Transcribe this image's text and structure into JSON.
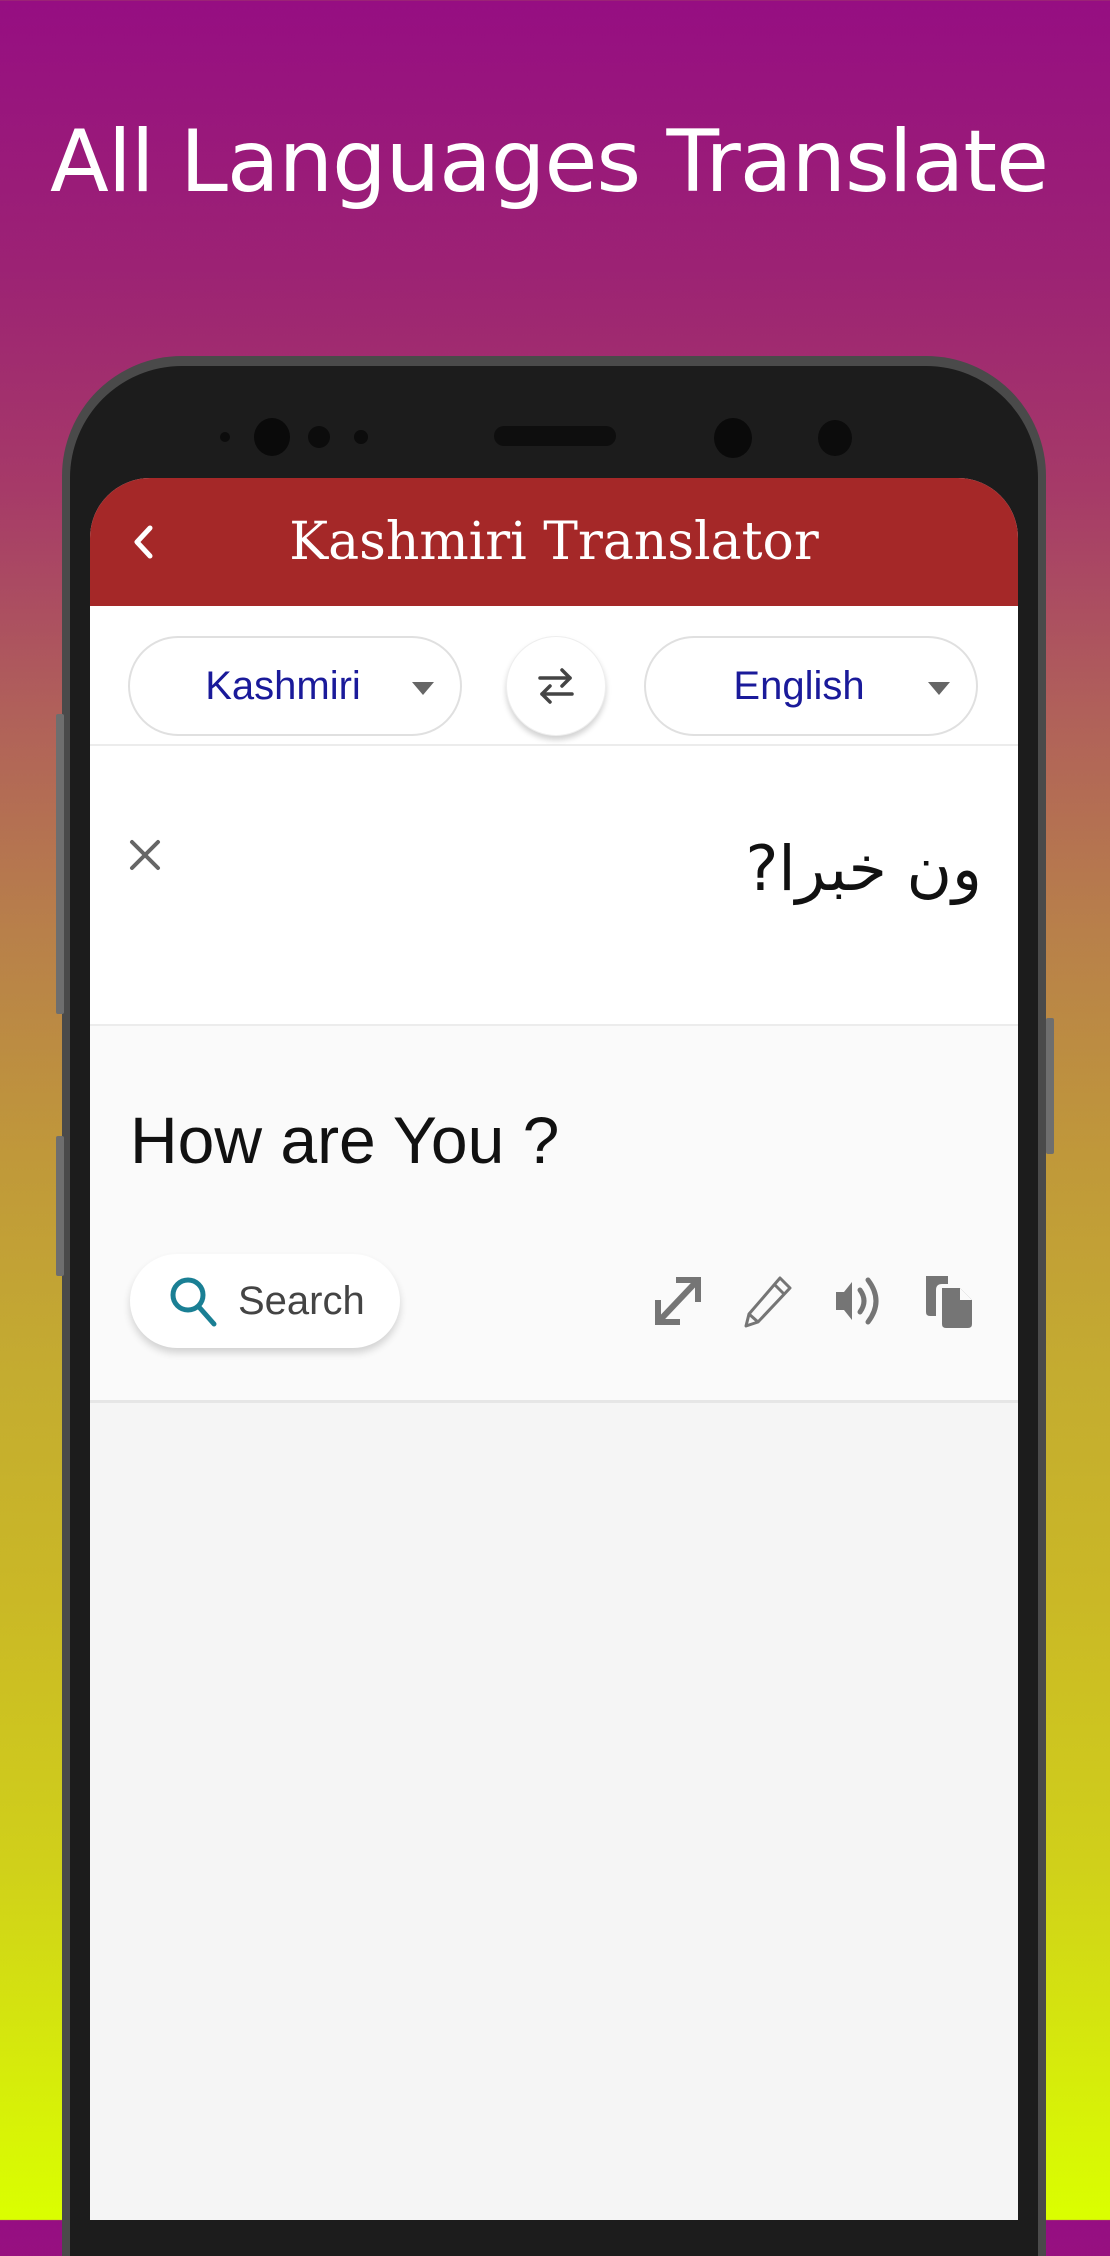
{
  "promo": {
    "headline": "All Languages Translate"
  },
  "appbar": {
    "title": "Kashmiri Translator",
    "back_icon": "chevron-left-icon"
  },
  "languages": {
    "source": "Kashmiri",
    "target": "English",
    "swap_icon": "swap-arrows-icon"
  },
  "input": {
    "text": "ون خبرا?",
    "clear_icon": "close-icon"
  },
  "output": {
    "text": "How are You ?",
    "search_label": "Search",
    "actions": [
      "expand-icon",
      "edit-pencil-icon",
      "speaker-icon",
      "copy-icon"
    ]
  },
  "colors": {
    "appbar": "#a52828",
    "language_text": "#1a1a9a",
    "search_icon": "#1a7f94",
    "action_icons": "#757575"
  }
}
